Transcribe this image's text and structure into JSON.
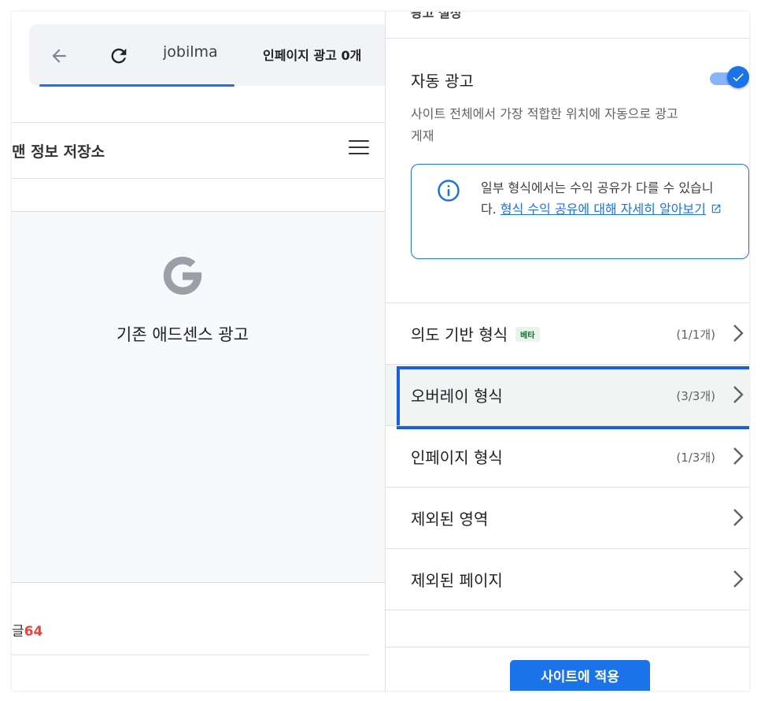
{
  "preview": {
    "tab1_label": "jobilma",
    "tab2_label": "인페이지 광고 0개",
    "site_title": "맨 정보 저장소",
    "ad_label": "기존 애드센스 광고",
    "posts_label": "글",
    "posts_count": "64"
  },
  "panel": {
    "section_header": "광고 설정",
    "auto_ads": {
      "title": "자동 광고",
      "description": "사이트 전체에서 가장 적합한 위치에 자동으로 광고 게재",
      "enabled": true
    },
    "info": {
      "text": "일부 형식에서는 수익 공유가 다를 수 있습니다. ",
      "link": "형식 수익 공유에 대해 자세히 알아보기"
    },
    "rows": [
      {
        "label": "의도 기반 형식",
        "badge": "베타",
        "count": "(1/1개)"
      },
      {
        "label": "오버레이 형식",
        "count": "(3/3개)"
      },
      {
        "label": "인페이지 형식",
        "count": "(1/3개)"
      },
      {
        "label": "제외된 영역"
      },
      {
        "label": "제외된 페이지"
      }
    ],
    "apply_label": "사이트에 적용"
  },
  "colors": {
    "accent": "#1a73e8",
    "highlight": "#1a5fdc",
    "posts_count": "#e8453c",
    "beta_text": "#137333"
  }
}
